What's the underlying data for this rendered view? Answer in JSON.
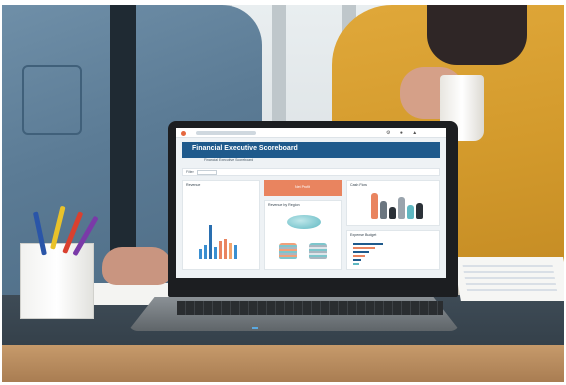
{
  "scene": {
    "description_alt": "",
    "colors": {
      "shirt": "#5b7b95",
      "cardigan": "#d39a2c",
      "desk": "#2e3942",
      "dashboard_header": "#1f5a8c",
      "dashboard_accent": "#e9845f"
    }
  },
  "dashboard": {
    "title": "Financial Executive Scoreboard",
    "tab_label": "Financial Executive Scoreboard",
    "filter_label": "Filter",
    "panels": {
      "p1_title": "Revenue",
      "p2_title": "Net Profit",
      "p3_title": "Revenue by Region",
      "p4_title": "Cash Flow",
      "p5_title": "Expense Budget"
    },
    "icons": {
      "topbar": [
        "settings-icon",
        "bell-icon",
        "user-icon"
      ]
    }
  }
}
